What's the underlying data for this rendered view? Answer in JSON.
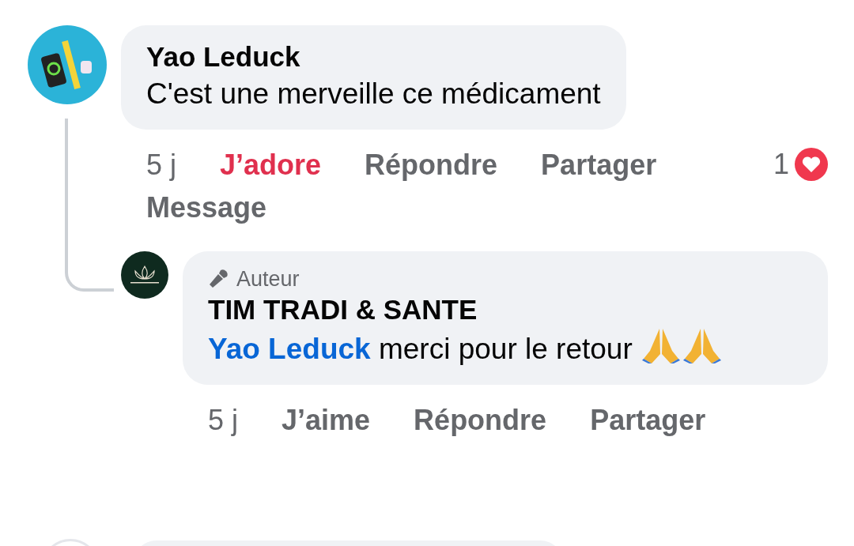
{
  "comment": {
    "author": "Yao Leduck",
    "text": "C'est une merveille ce médicament",
    "actions": [
      {
        "kind": "time",
        "label": "5 j"
      },
      {
        "kind": "like",
        "label": "J’adore",
        "selected": true
      },
      {
        "kind": "link",
        "label": "Répondre"
      },
      {
        "kind": "link",
        "label": "Partager"
      },
      {
        "kind": "link",
        "label": "Message"
      }
    ],
    "reactions": {
      "count": "1"
    }
  },
  "reply": {
    "badge": "Auteur",
    "author": "TIM TRADI & SANTE",
    "mention": "Yao Leduck",
    "text": "merci pour le retour",
    "emojis": [
      {
        "kind": "praying-hands"
      },
      {
        "kind": "praying-hands"
      }
    ],
    "actions": [
      {
        "kind": "time",
        "label": "5 j"
      },
      {
        "kind": "like",
        "label": "J’aime",
        "selected": false
      },
      {
        "kind": "link",
        "label": "Répondre"
      },
      {
        "kind": "link",
        "label": "Partager"
      }
    ]
  }
}
